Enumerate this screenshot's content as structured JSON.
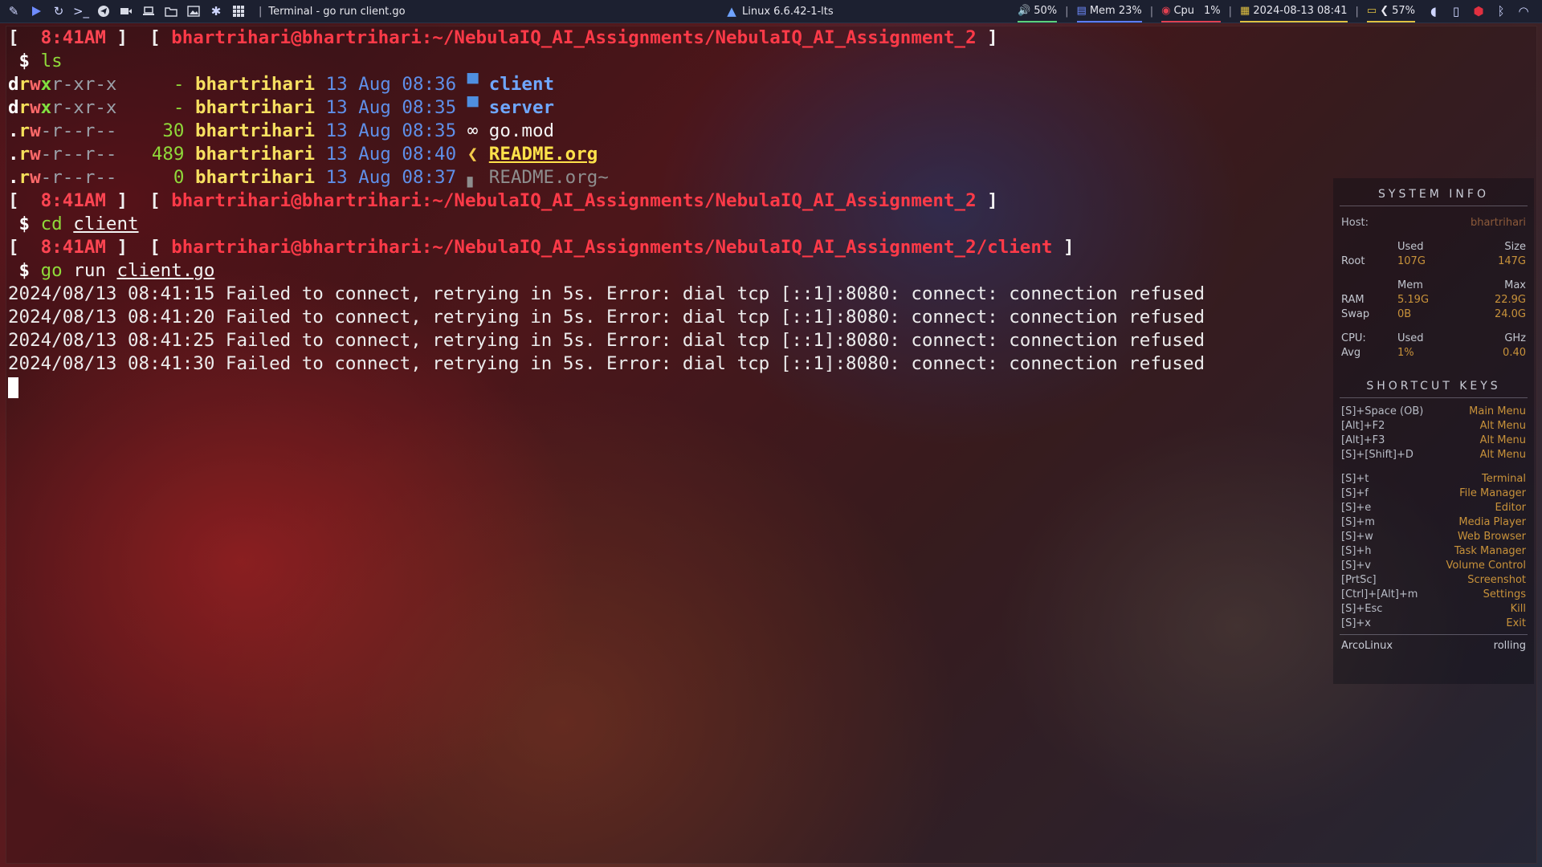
{
  "panel": {
    "window_title": "Terminal - go run client.go",
    "kernel": "Linux 6.6.42-1-lts",
    "volume": "50%",
    "mem": "Mem 23%",
    "cpu_label": "Cpu",
    "cpu_value": "1%",
    "datetime": "2024-08-13 08:41",
    "battery": "57%",
    "separator": "|"
  },
  "terminal": {
    "prompt_time": "8:41AM",
    "prompt_path_1": "bhartrihari@bhartrihari:~/NebulaIQ_AI_Assignments/NebulaIQ_AI_Assignment_2",
    "prompt_path_2": "bhartrihari@bhartrihari:~/NebulaIQ_AI_Assignments/NebulaIQ_AI_Assignment_2/client",
    "cmd_ls": "ls",
    "cmd_cd": "cd",
    "cmd_cd_arg": "client",
    "cmd_go": "go",
    "cmd_go_run": "run",
    "cmd_go_arg": "client.go",
    "files": [
      {
        "d": "d",
        "r1": "r",
        "w1": "w",
        "x1": "x",
        "rest": "r-xr-x",
        "size": "-",
        "user": "bhartrihari",
        "date": "13 Aug 08:36",
        "icon": "▀",
        "name": "client"
      },
      {
        "d": "d",
        "r1": "r",
        "w1": "w",
        "x1": "x",
        "rest": "r-xr-x",
        "size": "-",
        "user": "bhartrihari",
        "date": "13 Aug 08:35",
        "icon": "▀",
        "name": "server"
      },
      {
        "d": ".",
        "r1": "r",
        "w1": "w",
        "x1": "-",
        "rest": "r--r--",
        "size": "30",
        "user": "bhartrihari",
        "date": "13 Aug 08:35",
        "icon": "∞",
        "name": "go.mod"
      },
      {
        "d": ".",
        "r1": "r",
        "w1": "w",
        "x1": "-",
        "rest": "r--r--",
        "size": "489",
        "user": "bhartrihari",
        "date": "13 Aug 08:40",
        "icon": "❮",
        "name": "README.org"
      },
      {
        "d": ".",
        "r1": "r",
        "w1": "w",
        "x1": "-",
        "rest": "r--r--",
        "size": "0",
        "user": "bhartrihari",
        "date": "13 Aug 08:37",
        "icon": "▖",
        "name": "README.org~"
      }
    ],
    "log_lines": [
      "2024/08/13 08:41:15 Failed to connect, retrying in 5s. Error: dial tcp [::1]:8080: connect: connection refused",
      "2024/08/13 08:41:20 Failed to connect, retrying in 5s. Error: dial tcp [::1]:8080: connect: connection refused",
      "2024/08/13 08:41:25 Failed to connect, retrying in 5s. Error: dial tcp [::1]:8080: connect: connection refused",
      "2024/08/13 08:41:30 Failed to connect, retrying in 5s. Error: dial tcp [::1]:8080: connect: connection refused"
    ]
  },
  "conky": {
    "system_info_title": "SYSTEM INFO",
    "host_label": "Host:",
    "host_value": "bhartrihari",
    "used_header": "Used",
    "size_header": "Size",
    "root_label": "Root",
    "root_used": "107G",
    "root_size": "147G",
    "mem_header": "Mem",
    "max_header": "Max",
    "ram_label": "RAM",
    "ram_used": "5.19G",
    "ram_max": "22.9G",
    "swap_label": "Swap",
    "swap_used": "0B",
    "swap_max": "24.0G",
    "cpu_label": "CPU:",
    "cpu_used_header": "Used",
    "ghz_header": "GHz",
    "avg_label": "Avg",
    "avg_used": "1%",
    "avg_ghz": "0.40",
    "shortcut_title": "SHORTCUT KEYS",
    "shortcuts_1": [
      {
        "key": "[S]+Space (OB)",
        "action": "Main Menu"
      },
      {
        "key": "[Alt]+F2",
        "action": "Alt Menu"
      },
      {
        "key": "[Alt]+F3",
        "action": "Alt Menu"
      },
      {
        "key": "[S]+[Shift]+D",
        "action": "Alt Menu"
      }
    ],
    "shortcuts_2": [
      {
        "key": "[S]+t",
        "action": "Terminal"
      },
      {
        "key": "[S]+f",
        "action": "File Manager"
      },
      {
        "key": "[S]+e",
        "action": "Editor"
      },
      {
        "key": "[S]+m",
        "action": "Media Player"
      },
      {
        "key": "[S]+w",
        "action": "Web Browser"
      },
      {
        "key": "[S]+h",
        "action": "Task Manager"
      },
      {
        "key": "[S]+v",
        "action": "Volume Control"
      },
      {
        "key": "[PrtSc]",
        "action": "Screenshot"
      },
      {
        "key": "[Ctrl]+[Alt]+m",
        "action": "Settings"
      },
      {
        "key": "[S]+Esc",
        "action": "Kill"
      },
      {
        "key": "[S]+x",
        "action": "Exit"
      }
    ],
    "distro": "ArcoLinux",
    "release": "rolling"
  }
}
